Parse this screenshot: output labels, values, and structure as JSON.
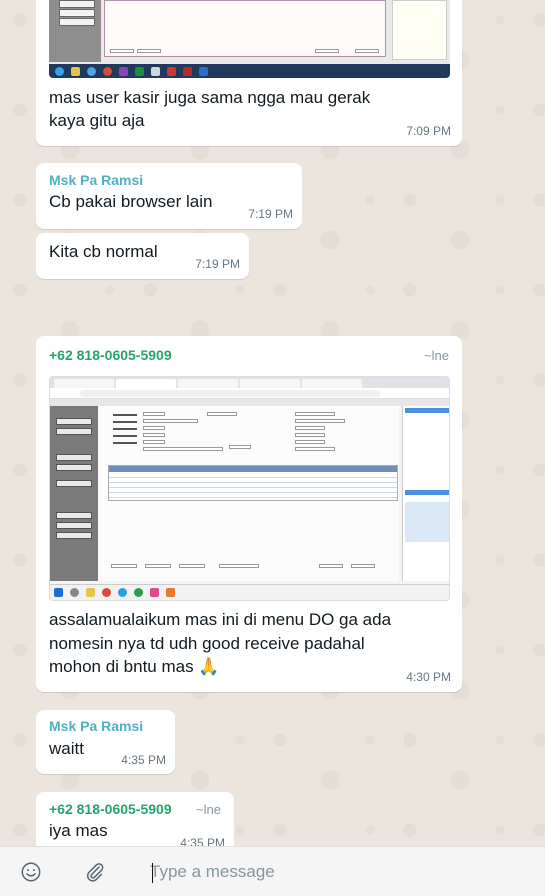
{
  "colors": {
    "sender_name": "#4fb0c6",
    "sender_phone": "#25a56a",
    "bubble": "#ffffff",
    "wallpaper": "#ece5dd",
    "timestamp": "#667781"
  },
  "messages": [
    {
      "type": "image_with_caption",
      "image": "desktop-screenshot",
      "caption_line1": "mas user kasir juga sama ngga mau gerak",
      "caption_line2": "kaya gitu aja",
      "time": "7:09 PM"
    },
    {
      "type": "text",
      "sender": "Msk Pa Ramsi",
      "text": "Cb pakai browser lain",
      "time": "7:19 PM"
    },
    {
      "type": "text",
      "text": "Kita cb normal",
      "time": "7:19 PM"
    },
    {
      "type": "image_with_caption",
      "sender": "+62 818-0605-5909",
      "alias": "~lne",
      "image": "browser-app-screenshot",
      "caption_line1": "assalamualaikum mas ini di menu DO ga ada",
      "caption_line2": "nomesin nya td udh good receive padahal",
      "caption_line3": "mohon di bntu mas 🙏",
      "time": "4:30 PM"
    },
    {
      "type": "text",
      "sender": "Msk Pa Ramsi",
      "text": "waitt",
      "time": "4:35 PM"
    },
    {
      "type": "text",
      "sender": "+62 818-0605-5909",
      "alias": "~lne",
      "text": "iya mas",
      "time": "4:35 PM"
    }
  ],
  "input": {
    "placeholder": "Type a message",
    "emoji_icon": "emoji-icon",
    "attach_icon": "paperclip-icon"
  }
}
